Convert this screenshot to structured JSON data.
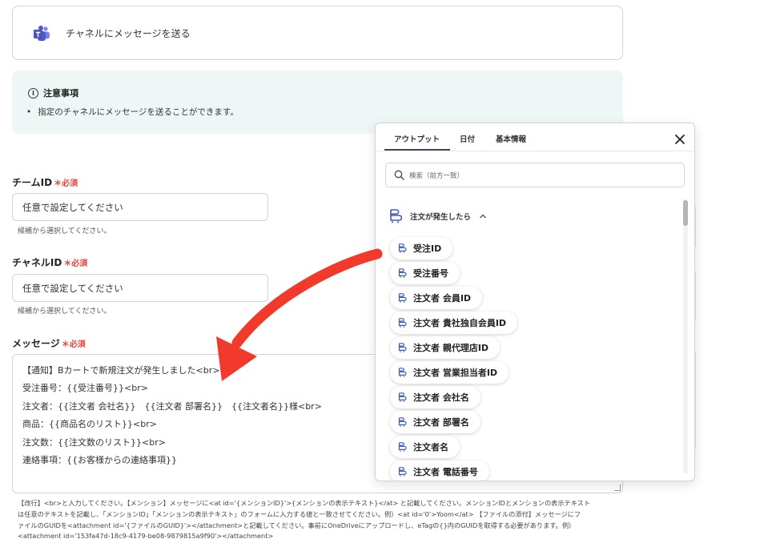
{
  "action": {
    "label": "チャネルにメッセージを送る",
    "icon": "teams-icon"
  },
  "notice": {
    "title": "注意事項",
    "items": [
      "指定のチャネルにメッセージを送ることができます。"
    ]
  },
  "required_mark": "＊必須",
  "fields": {
    "team_id": {
      "label": "チームID",
      "value": "任意で設定してください",
      "hint": "候補から選択してください。"
    },
    "channel_id": {
      "label": "チャネルID",
      "value": "任意で設定してください",
      "hint": "候補から選択してください。"
    },
    "message": {
      "label": "メッセージ",
      "lines": [
        "【通知】Bカートで新規注文が発生しました<br>",
        "受注番号：{{受注番号}}<br>",
        "注文者：{{注文者 会社名}}　{{注文者 部署名}}　{{注文者名}}様<br>",
        "商品：{{商品名のリスト}}<br>",
        "注文数：{{注文数のリスト}}<br>",
        "連絡事項：{{お客様からの連絡事項}}"
      ]
    }
  },
  "help": {
    "lines": [
      "【改行】<br>と入力してください。【メンション】メッセージに<at id='{メンションID}'>{メンションの表示テキスト}</at> と記載してください。メンションIDとメンションの表示テキスト",
      "は任意のテキストを記載し、「メンションID」「メンションの表示テキスト」のフォームに入力する値と一致させてください。例）<at id='0'>Yoom</at>  【ファイルの添付】メッセージにフ",
      "ァイルのGUIDを<attachment id='{ファイルのGUID}'></attachment>と記載してください。事前にOneDriveにアップロードし、eTagの{}内のGUIDを取得する必要があります。例）",
      "<attachment id='153fa47d-18c9-4179-be08-9879815a9f90'></attachment>"
    ]
  },
  "popover": {
    "tabs": [
      "アウトプット",
      "日付",
      "基本情報"
    ],
    "active_tab": "アウトプット",
    "search_placeholder": "検索（前方一致）",
    "group": {
      "label": "注文が発生したら",
      "expanded": true
    },
    "items": [
      "受注ID",
      "受注番号",
      "注文者 会員ID",
      "注文者 貴社独自会員ID",
      "注文者 親代理店ID",
      "注文者 営業担当者ID",
      "注文者 会社名",
      "注文者 部署名",
      "注文者名",
      "注文者 電話番号"
    ]
  },
  "colors": {
    "required": "#e8413b",
    "notice_bg": "#eef7f6",
    "arrow": "#f23a2c",
    "tab_underline": "#3c4a5a"
  }
}
